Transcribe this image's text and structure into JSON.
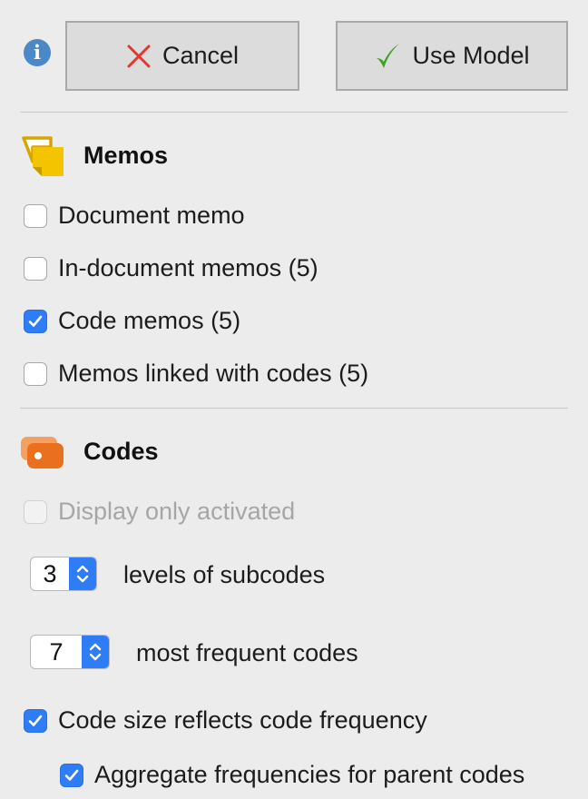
{
  "toolbar": {
    "cancel_label": "Cancel",
    "use_model_label": "Use Model"
  },
  "memos": {
    "title": "Memos",
    "options": [
      {
        "label": "Document memo",
        "checked": false
      },
      {
        "label": "In-document memos (5)",
        "checked": false
      },
      {
        "label": "Code memos (5)",
        "checked": true
      },
      {
        "label": "Memos linked with codes (5)",
        "checked": false
      }
    ]
  },
  "codes": {
    "title": "Codes",
    "display_only_activated": {
      "label": "Display only activated",
      "checked": false,
      "disabled": true
    },
    "levels_of_subcodes": {
      "value": "3",
      "label": "levels of subcodes"
    },
    "most_frequent_codes": {
      "value": "7",
      "label": "most frequent codes"
    },
    "code_size_reflects_frequency": {
      "label": "Code size reflects code frequency",
      "checked": true
    },
    "aggregate_parent_frequencies": {
      "label": "Aggregate frequencies for parent codes",
      "checked": true
    }
  },
  "colors": {
    "accent_blue": "#2e7cf6",
    "info_blue": "#4a88c8",
    "cancel_red": "#e0382c",
    "check_green": "#3fa320",
    "memo_yellow": "#f5c400",
    "code_orange": "#e9701f"
  },
  "icons": {
    "info": "info-icon",
    "cancel": "x-icon",
    "use_model": "checkmark-icon",
    "memos": "memo-icon",
    "codes": "code-icon"
  }
}
